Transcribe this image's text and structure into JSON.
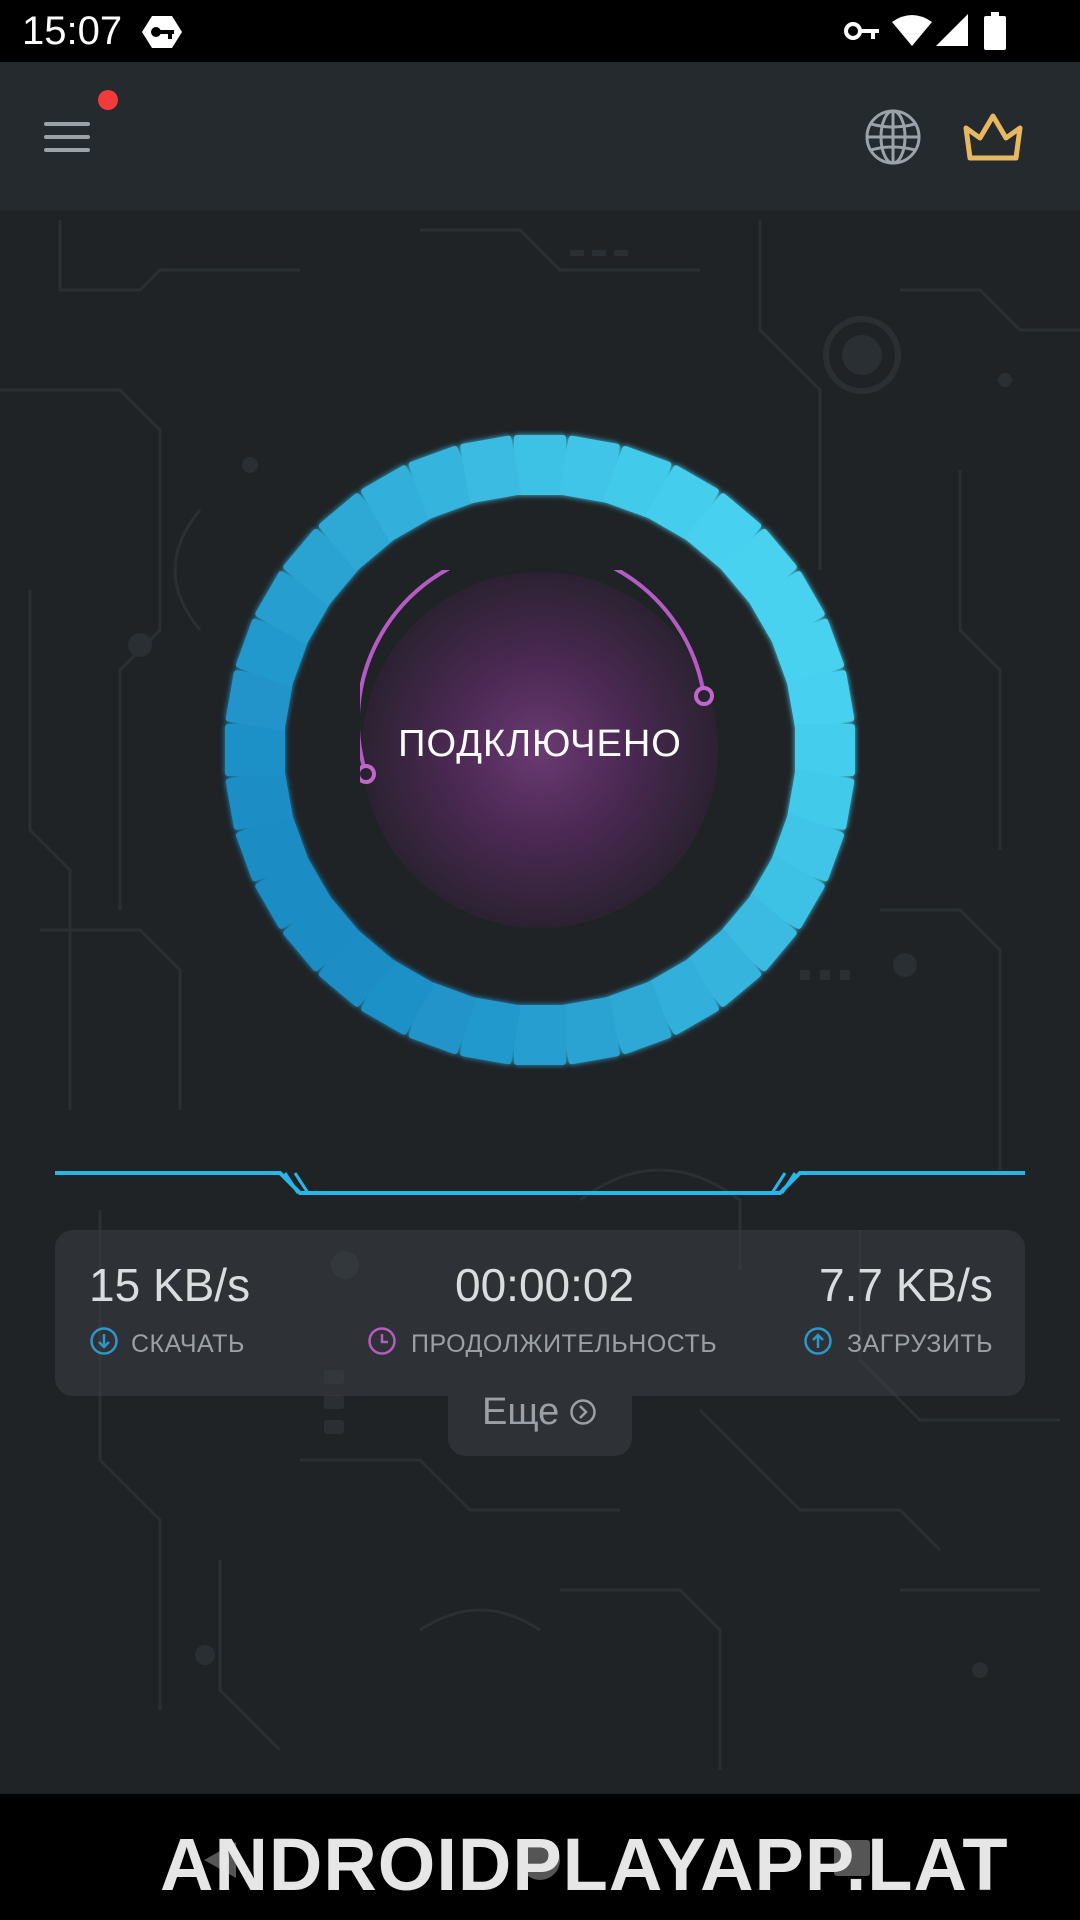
{
  "status_bar": {
    "time": "15:07",
    "icons": [
      "vpn-badge-icon",
      "key-icon",
      "wifi-icon",
      "cell-signal-icon",
      "battery-icon"
    ]
  },
  "app_bar": {
    "icons": [
      "menu-icon",
      "globe-icon",
      "crown-icon"
    ],
    "notification_dot": true
  },
  "connection": {
    "status": "ПОДКЛЮЧЕНО"
  },
  "stats": {
    "download": {
      "value": "15 KB/s",
      "label": "СКАЧАТЬ",
      "icon": "download-arrow-icon"
    },
    "duration": {
      "value": "00:00:02",
      "label": "ПРОДОЛЖИТЕЛЬНОСТЬ",
      "icon": "clock-icon"
    },
    "upload": {
      "value": "7.7 KB/s",
      "label": "ЗАГРУЗИТЬ",
      "icon": "upload-arrow-icon"
    }
  },
  "more": {
    "label": "Еще",
    "icon": "chevron-right-circle-icon"
  },
  "watermark": "ANDROIDPLAYAPP.LAT",
  "colors": {
    "accent_blue": "#2eb6e2",
    "accent_purple": "#b45bc4",
    "crown_gold": "#e8b860",
    "notification_red": "#f23a3a"
  }
}
